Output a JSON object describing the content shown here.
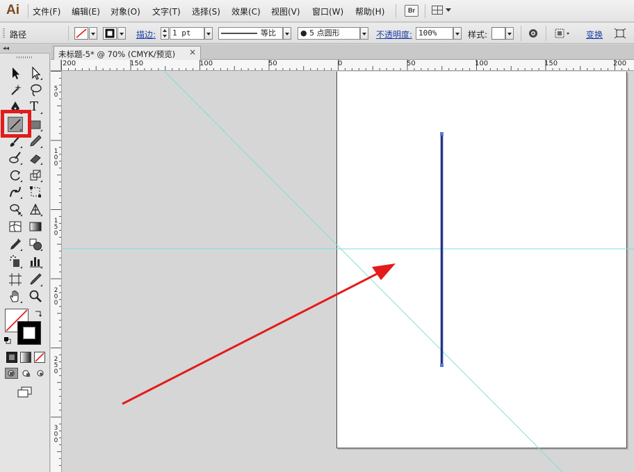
{
  "app": {
    "logo": "Ai"
  },
  "menu": [
    "文件(F)",
    "编辑(E)",
    "对象(O)",
    "文字(T)",
    "选择(S)",
    "效果(C)",
    "视图(V)",
    "窗口(W)",
    "帮助(H)"
  ],
  "menu_extras": {
    "bridge_label": "Br"
  },
  "control": {
    "selection_type": "路径",
    "stroke_label": "描边:",
    "stroke_weight": "1 pt",
    "stroke_profile": "等比",
    "brush": "● 5 点圆形",
    "opacity_label": "不透明度:",
    "opacity": "100%",
    "style_label": "样式:",
    "transform_label": "变换"
  },
  "document": {
    "tab_title": "未标题-5* @ 70% (CMYK/预览)",
    "close_glyph": "×"
  },
  "rulers": {
    "horizontal": [
      "200",
      "150",
      "100",
      "50",
      "0",
      "50",
      "100",
      "150",
      "200"
    ],
    "vertical": [
      "50",
      "100",
      "150",
      "200",
      "250",
      "300"
    ]
  },
  "toolbox": {
    "collapse_glyph": "◂◂",
    "type_tool_glyph": "T"
  },
  "colors": {
    "guide": "#7fdede",
    "annotation": "#e31b1b",
    "selected_path": "#1a1a4a",
    "selection_highlight": "#5b7bd6",
    "link": "#1b3fa8"
  }
}
